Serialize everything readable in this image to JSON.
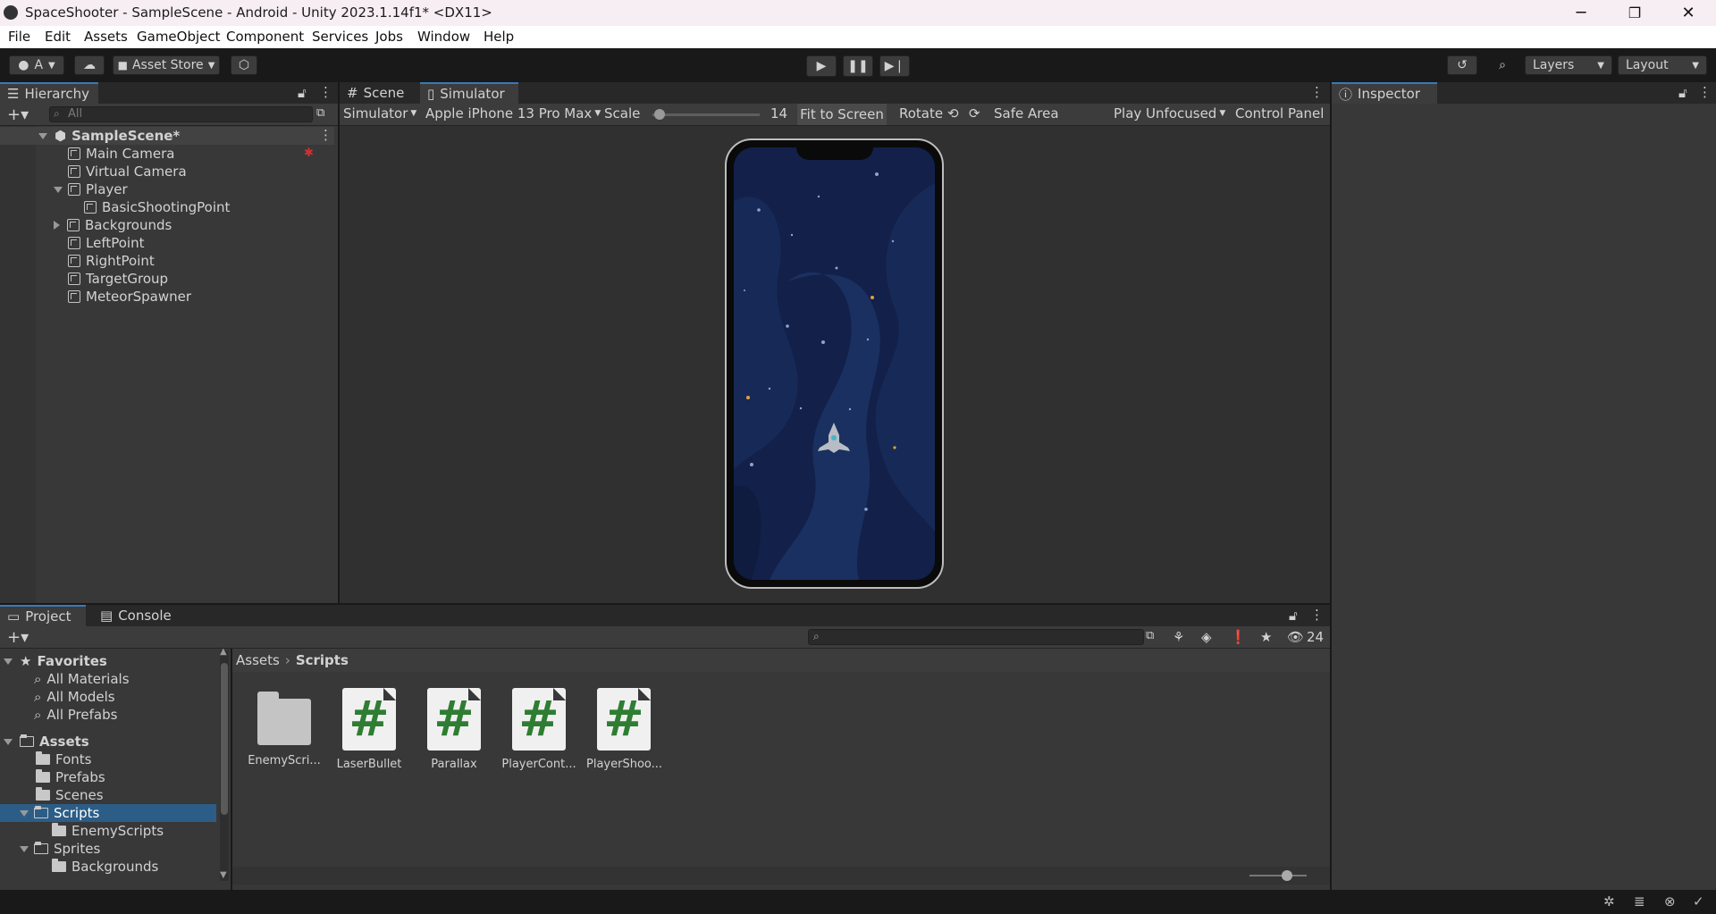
{
  "window": {
    "title": "SpaceShooter - SampleScene - Android - Unity 2023.1.14f1* <DX11>",
    "minimize": "─",
    "maximize": "❐",
    "close": "✕"
  },
  "menu": [
    "File",
    "Edit",
    "Assets",
    "GameObject",
    "Component",
    "Services",
    "Jobs",
    "Window",
    "Help"
  ],
  "toolbar": {
    "account": "A",
    "asset_store": "Asset Store",
    "layers": "Layers",
    "layout": "Layout"
  },
  "hierarchy": {
    "tab": "Hierarchy",
    "search_placeholder": "All",
    "scene": "SampleScene*",
    "items": [
      "Main Camera",
      "Virtual Camera",
      "Player",
      "BasicShootingPoint",
      "Backgrounds",
      "LeftPoint",
      "RightPoint",
      "TargetGroup",
      "MeteorSpawner"
    ]
  },
  "viewport": {
    "tabs": [
      "Scene",
      "Simulator"
    ],
    "mode": "Simulator",
    "device": "Apple iPhone 13 Pro Max",
    "scale_label": "Scale",
    "scale_value": "14",
    "fit": "Fit to Screen",
    "rotate": "Rotate",
    "safe_area": "Safe Area",
    "play_mode": "Play Unfocused",
    "control_panel": "Control Panel"
  },
  "inspector": {
    "tab": "Inspector"
  },
  "project": {
    "tabs": [
      "Project",
      "Console"
    ],
    "hidden_count": "24",
    "favorites_label": "Favorites",
    "favorites": [
      "All Materials",
      "All Models",
      "All Prefabs"
    ],
    "assets_label": "Assets",
    "tree": [
      "Fonts",
      "Prefabs",
      "Scenes",
      "Scripts",
      "EnemyScripts",
      "Sprites",
      "Backgrounds"
    ],
    "breadcrumb": [
      "Assets",
      "Scripts"
    ],
    "files": [
      "EnemyScri...",
      "LaserBullet",
      "Parallax",
      "PlayerCont...",
      "PlayerShoo..."
    ]
  },
  "colors": {
    "selection": "#2c5d87",
    "accent": "#3a79bb",
    "game_bg": "#13224a",
    "script_hash": "#2e7d32"
  }
}
